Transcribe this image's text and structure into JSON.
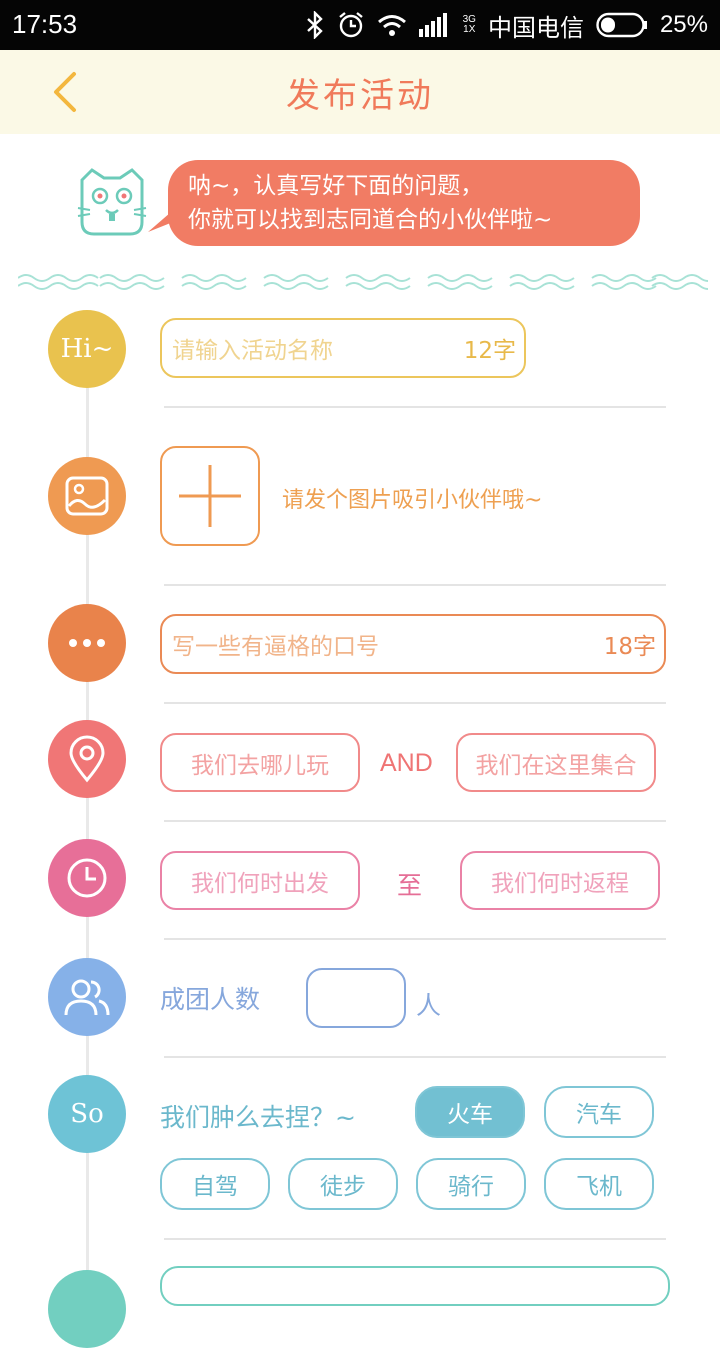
{
  "status_bar": {
    "time": "17:53",
    "network_top": "3G",
    "network_bottom": "1X",
    "carrier": "中国电信",
    "battery": "25%"
  },
  "header": {
    "title": "发布活动",
    "back_icon": "chevron-left-icon"
  },
  "intro": {
    "line1": "呐~，认真写好下面的问题，",
    "line2": "你就可以找到志同道合的小伙伴啦~"
  },
  "activity_name": {
    "icon_text": "Hi~",
    "placeholder": "请输入活动名称",
    "limit": "12字"
  },
  "photo": {
    "hint": "请发个图片吸引小伙伴哦~"
  },
  "slogan": {
    "placeholder": "写一些有逼格的口号",
    "limit": "18字"
  },
  "location": {
    "destination": "我们去哪儿玩",
    "connector": "AND",
    "meeting_point": "我们在这里集合"
  },
  "time": {
    "depart": "我们何时出发",
    "connector": "至",
    "return": "我们何时返程"
  },
  "group": {
    "label": "成团人数",
    "unit": "人"
  },
  "transport": {
    "icon_text": "So",
    "label": "我们肿么去捏？~",
    "options": [
      "火车",
      "汽车",
      "自驾",
      "徒步",
      "骑行",
      "飞机"
    ],
    "selected": "火车"
  },
  "colors": {
    "header_bg": "#fbf9e6",
    "title": "#f07a5a",
    "bubble": "#f17c64",
    "yellow": "#e9c24e",
    "orange": "#ef9a52",
    "deep_orange": "#e9834b",
    "coral": "#f07676",
    "pink": "#e76f98",
    "blue": "#86b1e8",
    "teal": "#6ec3d6"
  }
}
